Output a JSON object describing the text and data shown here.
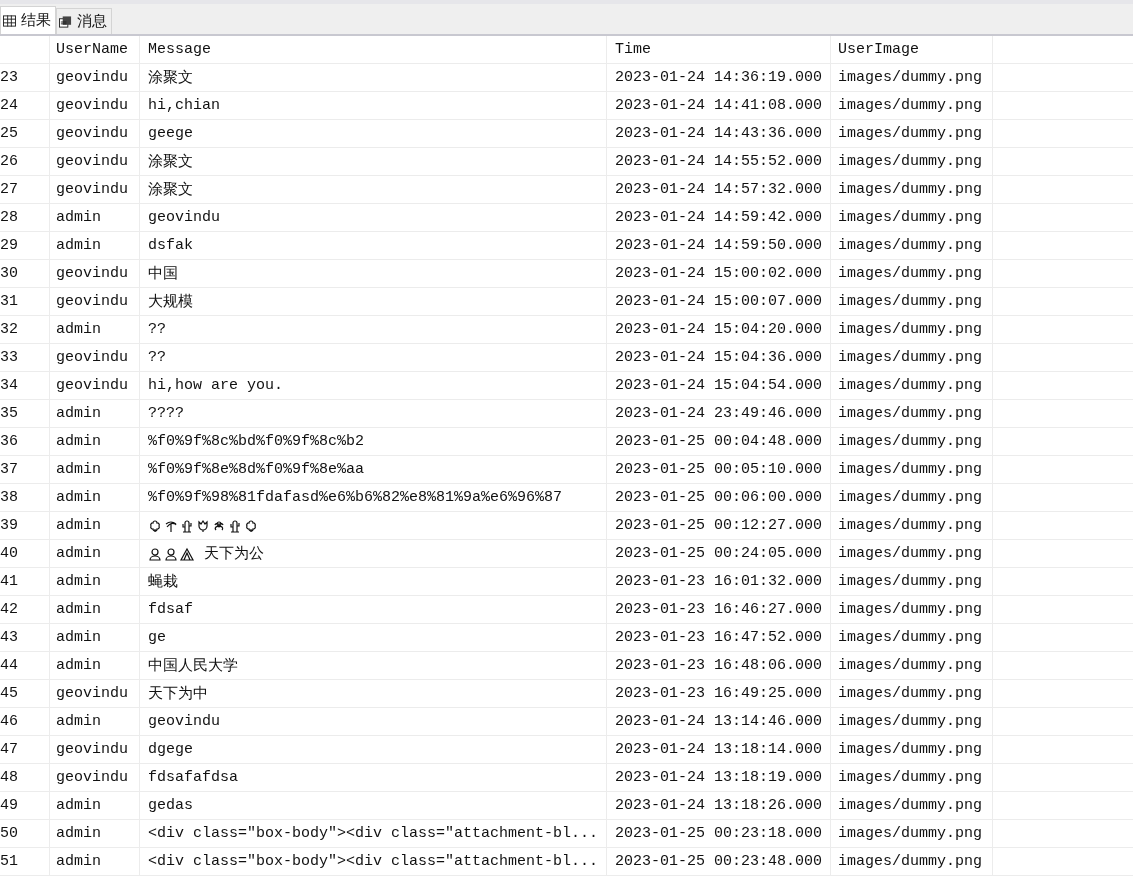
{
  "tabs": [
    {
      "label": "结果",
      "selected": true
    },
    {
      "label": "消息",
      "selected": false
    }
  ],
  "table": {
    "columns": [
      "UserName",
      "Message",
      "Time",
      "UserImage"
    ],
    "rows": [
      {
        "row_number": "23",
        "user": "geovindu",
        "message": "涂聚文",
        "time": "2023-01-24 14:36:19.000",
        "image": "images/dummy.png"
      },
      {
        "row_number": "24",
        "user": "geovindu",
        "message": "hi,chian",
        "time": "2023-01-24 14:41:08.000",
        "image": "images/dummy.png"
      },
      {
        "row_number": "25",
        "user": "geovindu",
        "message": "geege",
        "time": "2023-01-24 14:43:36.000",
        "image": "images/dummy.png"
      },
      {
        "row_number": "26",
        "user": "geovindu",
        "message": "涂聚文",
        "time": "2023-01-24 14:55:52.000",
        "image": "images/dummy.png"
      },
      {
        "row_number": "27",
        "user": "geovindu",
        "message": "涂聚文",
        "time": "2023-01-24 14:57:32.000",
        "image": "images/dummy.png"
      },
      {
        "row_number": "28",
        "user": "admin",
        "message": "geovindu",
        "time": "2023-01-24 14:59:42.000",
        "image": "images/dummy.png"
      },
      {
        "row_number": "29",
        "user": "admin",
        "message": "dsfak",
        "time": "2023-01-24 14:59:50.000",
        "image": "images/dummy.png"
      },
      {
        "row_number": "30",
        "user": "geovindu",
        "message": "中国",
        "time": "2023-01-24 15:00:02.000",
        "image": "images/dummy.png"
      },
      {
        "row_number": "31",
        "user": "geovindu",
        "message": "大规模",
        "time": "2023-01-24 15:00:07.000",
        "image": "images/dummy.png"
      },
      {
        "row_number": "32",
        "user": "admin",
        "message": "??",
        "time": "2023-01-24 15:04:20.000",
        "image": "images/dummy.png"
      },
      {
        "row_number": "33",
        "user": "geovindu",
        "message": "??",
        "time": "2023-01-24 15:04:36.000",
        "image": "images/dummy.png"
      },
      {
        "row_number": "34",
        "user": "geovindu",
        "message": "hi,how are you.",
        "time": "2023-01-24 15:04:54.000",
        "image": "images/dummy.png"
      },
      {
        "row_number": "35",
        "user": "admin",
        "message": "????",
        "time": "2023-01-24 23:49:46.000",
        "image": "images/dummy.png"
      },
      {
        "row_number": "36",
        "user": "admin",
        "message": "%f0%9f%8c%bd%f0%9f%8c%b2",
        "time": "2023-01-25 00:04:48.000",
        "image": "images/dummy.png"
      },
      {
        "row_number": "37",
        "user": "admin",
        "message": "%f0%9f%8e%8d%f0%9f%8e%aa",
        "time": "2023-01-25 00:05:10.000",
        "image": "images/dummy.png"
      },
      {
        "row_number": "38",
        "user": "admin",
        "message": "%f0%9f%98%81fdafasd%e6%b6%82%e8%81%9a%e6%96%87",
        "time": "2023-01-25 00:06:00.000",
        "image": "images/dummy.png"
      },
      {
        "row_number": "39",
        "user": "admin",
        "kind": "flowers",
        "time": "2023-01-25 00:12:27.000",
        "image": "images/dummy.png"
      },
      {
        "row_number": "40",
        "user": "admin",
        "kind": "people",
        "message": "天下为公",
        "time": "2023-01-25 00:24:05.000",
        "image": "images/dummy.png"
      },
      {
        "row_number": "41",
        "user": "admin",
        "message": "蝇栽",
        "time": "2023-01-23 16:01:32.000",
        "image": "images/dummy.png"
      },
      {
        "row_number": "42",
        "user": "admin",
        "message": "fdsaf",
        "time": "2023-01-23 16:46:27.000",
        "image": "images/dummy.png"
      },
      {
        "row_number": "43",
        "user": "admin",
        "message": "ge",
        "time": "2023-01-23 16:47:52.000",
        "image": "images/dummy.png"
      },
      {
        "row_number": "44",
        "user": "admin",
        "message": "中国人民大学",
        "time": "2023-01-23 16:48:06.000",
        "image": "images/dummy.png"
      },
      {
        "row_number": "45",
        "user": "geovindu",
        "message": "天下为中",
        "time": "2023-01-23 16:49:25.000",
        "image": "images/dummy.png"
      },
      {
        "row_number": "46",
        "user": "admin",
        "message": "geovindu",
        "time": "2023-01-24 13:14:46.000",
        "image": "images/dummy.png"
      },
      {
        "row_number": "47",
        "user": "geovindu",
        "message": "dgege",
        "time": "2023-01-24 13:18:14.000",
        "image": "images/dummy.png"
      },
      {
        "row_number": "48",
        "user": "geovindu",
        "message": "fdsafafdsa",
        "time": "2023-01-24 13:18:19.000",
        "image": "images/dummy.png"
      },
      {
        "row_number": "49",
        "user": "admin",
        "message": "gedas",
        "time": "2023-01-24 13:18:26.000",
        "image": "images/dummy.png"
      },
      {
        "row_number": "50",
        "user": "admin",
        "message": "<div class=\"box-body\"><div class=\"attachment-bl...",
        "time": "2023-01-25 00:23:18.000",
        "image": "images/dummy.png"
      },
      {
        "row_number": "51",
        "user": "admin",
        "message": "<div class=\"box-body\"><div class=\"attachment-bl...",
        "time": "2023-01-25 00:23:48.000",
        "image": "images/dummy.png"
      }
    ]
  }
}
